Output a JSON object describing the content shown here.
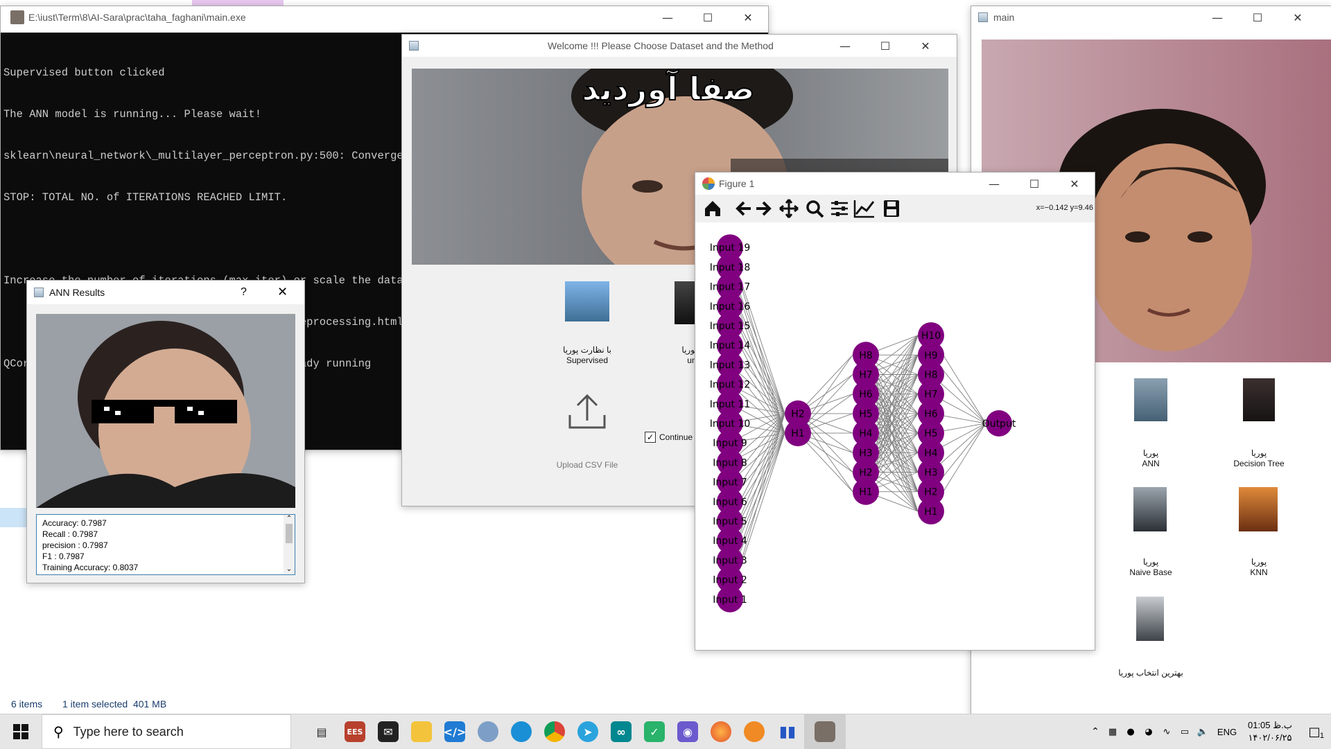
{
  "explorer": {
    "status_items": "6 items",
    "status_selected": "1 item selected  401 MB"
  },
  "console": {
    "title": "E:\\iust\\Term\\8\\AI-Sara\\prac\\taha_faghani\\main.exe",
    "lines": [
      "Supervised button clicked",
      "The ANN model is running... Please wait!",
      "sklearn\\neural_network\\_multilayer_perceptron.py:500: ConvergenceWarning: lbfgs failed to converge (status=1):",
      "STOP: TOTAL NO. of ITERATIONS REACHED LIMIT.",
      "",
      "Increase the number of iterations (max_iter) or scale the data as shown in:",
      "    https://scikit-learn.org/stable/modules/preprocessing.html",
      "QCoreApplication::exec: The event loop is already running"
    ]
  },
  "welcome": {
    "title": "Welcome !!!  Please Choose Dataset and the Method",
    "banner_text": "صفا آوردید",
    "option_supervised_fa": "با نظارت پوریا",
    "option_supervised": "Supervised",
    "option_unsupervised_fa": "بدون نظارت پوریا",
    "option_unsupervised": "unsupervised",
    "upload_label": "Upload CSV File",
    "continue_label": "Continue"
  },
  "ann_results": {
    "title": "ANN Results",
    "help_glyph": "?",
    "metrics": [
      "Accuracy: 0.7987",
      "Recall : 0.7987",
      "precision : 0.7987",
      "F1 : 0.7987",
      "Training Accuracy: 0.8037"
    ]
  },
  "figure": {
    "title": "Figure 1",
    "coords": "x=−0.142 y=9.46",
    "toolbar": [
      "home-icon",
      "back-icon",
      "forward-icon",
      "pan-icon",
      "zoom-icon",
      "configure-icon",
      "axes-icon",
      "save-icon"
    ],
    "node_color": "#800080",
    "edge_color": "#808080",
    "layers": [
      [
        "Input 19",
        "Input 18",
        "Input 17",
        "Input 16",
        "Input 15",
        "Input 14",
        "Input 13",
        "Input 12",
        "Input 11",
        "Input 10",
        "Input 9",
        "Input 8",
        "Input 7",
        "Input 6",
        "Input 5",
        "Input 4",
        "Input 3",
        "Input 2",
        "Input 1"
      ],
      [
        "H2",
        "H1"
      ],
      [
        "H8",
        "H7",
        "H6",
        "H5",
        "H4",
        "H3",
        "H2",
        "H1"
      ],
      [
        "H10",
        "H9",
        "H8",
        "H7",
        "H6",
        "H5",
        "H4",
        "H3",
        "H2",
        "H1"
      ],
      [
        "Output"
      ]
    ]
  },
  "main_window": {
    "title": "main",
    "thumbnails": [
      {
        "fa": "پوریا",
        "label": "ANN"
      },
      {
        "fa": "پوریا",
        "label": "Decision Tree"
      },
      {
        "fa": "پوریا",
        "label": "Naive Base"
      },
      {
        "fa": "پوریا",
        "label": "KNN"
      },
      {
        "fa": "بهترین انتخاب پوریا",
        "label": ""
      }
    ]
  },
  "taskbar": {
    "search_placeholder": "Type here to search",
    "apps": [
      "task-view-icon",
      "ees-app-icon",
      "mail-icon",
      "file-explorer-icon",
      "vscode-icon",
      "paint-icon",
      "edge-icon",
      "chrome-icon",
      "telegram-icon",
      "arduino-icon",
      "kaspersky-icon",
      "app-circle-icon",
      "firefox-icon",
      "app-orange-icon",
      "chart-app-icon",
      "running-app-icon"
    ],
    "language": "ENG",
    "time": "01:05 ب.ظ",
    "date": "۱۴۰۲/۰۶/۲۵",
    "notification_count": "1"
  }
}
